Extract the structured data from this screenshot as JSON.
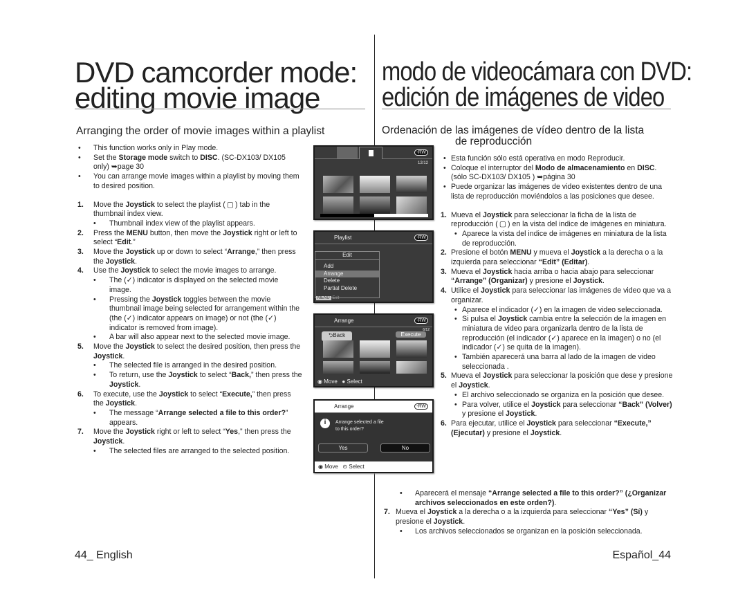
{
  "left": {
    "title_line1": "DVD camcorder mode:",
    "title_line2": "editing movie image",
    "subtitle": "Arranging the order of movie images within a playlist",
    "items": [
      {
        "k": "b",
        "parts": [
          "This function works only in Play mode."
        ]
      },
      {
        "k": "b",
        "parts": [
          "Set the ",
          {
            "b": "Storage mode"
          },
          " switch to ",
          {
            "b": "DISC"
          },
          ". (SC-DX103/ DX105 only) ➥page 30"
        ]
      },
      {
        "k": "b",
        "parts": [
          "You can arrange movie images within a playlist by moving them to desired position."
        ],
        "gap": true
      },
      {
        "k": "n",
        "num": "1.",
        "parts": [
          "Move the ",
          {
            "b": "Joystick"
          },
          " to select the playlist ( ▢ ) tab in the thumbnail index view."
        ]
      },
      {
        "k": "s",
        "parts": [
          "Thumbnail index view of the playlist appears."
        ]
      },
      {
        "k": "n",
        "num": "2.",
        "parts": [
          "Press the ",
          {
            "b": "MENU"
          },
          " button, then move the ",
          {
            "b": "Joystick"
          },
          " right or left to select “",
          {
            "b": "Edit"
          },
          ".”"
        ]
      },
      {
        "k": "n",
        "num": "3.",
        "parts": [
          "Move the ",
          {
            "b": "Joystick"
          },
          " up or down to select “",
          {
            "b": "Arrange"
          },
          ",” then press the ",
          {
            "b": "Joystick"
          },
          "."
        ]
      },
      {
        "k": "n",
        "num": "4.",
        "parts": [
          "Use the ",
          {
            "b": "Joystick"
          },
          " to select the movie images to arrange."
        ]
      },
      {
        "k": "s",
        "parts": [
          "The (✓) indicator is displayed on the selected movie image."
        ]
      },
      {
        "k": "s",
        "parts": [
          "Pressing the ",
          {
            "b": "Joystick"
          },
          " toggles between the movie thumbnail image being selected for arrangement within the (the (✓) indicator appears on image) or not (the (✓) indicator is removed from image)."
        ]
      },
      {
        "k": "s",
        "parts": [
          "A bar will also appear next to the selected movie image."
        ]
      },
      {
        "k": "n",
        "num": "5.",
        "parts": [
          "Move the ",
          {
            "b": "Joystick"
          },
          " to select the desired position, then press the ",
          {
            "b": "Joystick"
          },
          "."
        ]
      },
      {
        "k": "s",
        "parts": [
          "The selected file is arranged in the desired position."
        ]
      },
      {
        "k": "s",
        "parts": [
          "To return, use the ",
          {
            "b": "Joystick"
          },
          " to select “",
          {
            "b": "Back,"
          },
          "” then press the ",
          {
            "b": "Joystick"
          },
          "."
        ]
      },
      {
        "k": "n",
        "num": "6.",
        "parts": [
          "To execute, use the ",
          {
            "b": "Joystick"
          },
          " to select “",
          {
            "b": "Execute,"
          },
          "” then press the ",
          {
            "b": "Joystick"
          },
          "."
        ]
      },
      {
        "k": "s",
        "parts": [
          "The message “",
          {
            "b": "Arrange selected a file to this order?"
          },
          "” appears."
        ]
      },
      {
        "k": "n",
        "num": "7.",
        "parts": [
          "Move the ",
          {
            "b": "Joystick"
          },
          " right or left to select “",
          {
            "b": "Yes"
          },
          ",” then press the ",
          {
            "b": "Joystick"
          },
          "."
        ]
      },
      {
        "k": "s",
        "parts": [
          "The selected files are arranged to the selected position."
        ]
      }
    ],
    "footer": "44_ English"
  },
  "right": {
    "title_line1": "modo de videocámara con DVD:",
    "title_line2": "edición de imágenes de video",
    "subtitle_line1": "Ordenación de las imágenes de vídeo dentro de la lista",
    "subtitle_line2": "de reproducción",
    "items": [
      {
        "k": "b",
        "parts": [
          "Esta función sólo está operativa en modo Reproducir."
        ]
      },
      {
        "k": "b",
        "parts": [
          "Coloque el interruptor del ",
          {
            "b": "Modo de almacenamiento"
          },
          " en ",
          {
            "b": "DISC"
          },
          ". (sólo SC-DX103/ DX105 ) ➥página 30"
        ]
      },
      {
        "k": "b",
        "parts": [
          "Puede organizar las imágenes de video existentes dentro de una lista de reproducción moviéndolos a las posiciones que desee."
        ],
        "gap": true
      },
      {
        "k": "n",
        "num": "1.",
        "parts": [
          "Mueva el ",
          {
            "b": "Joystick"
          },
          " para seleccionar la ficha de la lista de reproducción ( ▢ ) en la vista del indice de imágenes en miniatura."
        ]
      },
      {
        "k": "s",
        "parts": [
          "Aparece la vista del indice de imágenes en miniatura de la lista de reproducción."
        ]
      },
      {
        "k": "n",
        "num": "2.",
        "parts": [
          "Presione el botón ",
          {
            "b": "MENU"
          },
          " y mueva el ",
          {
            "b": "Joystick"
          },
          " a la derecha o a la izquierda para seleccionar ",
          {
            "b": "“Edit” (Editar)"
          },
          "."
        ]
      },
      {
        "k": "n",
        "num": "3.",
        "parts": [
          "Mueva el ",
          {
            "b": "Joystick"
          },
          " hacia arriba o hacia abajo para seleccionar ",
          {
            "b": "“Arrange” (Organizar)"
          },
          " y presione el ",
          {
            "b": "Joystick"
          },
          "."
        ]
      },
      {
        "k": "n",
        "num": "4.",
        "parts": [
          "Utilice el ",
          {
            "b": "Joystick"
          },
          " para seleccionar las imágenes de video que va a organizar."
        ]
      },
      {
        "k": "s",
        "parts": [
          "Aparece el indicador (✓) en la imagen de video seleccionada."
        ]
      },
      {
        "k": "s",
        "parts": [
          "Si pulsa el ",
          {
            "b": "Joystick"
          },
          " cambia entre la selección de la imagen en miniatura de video para organizarla dentro de la lista de reproducción (el indicador (✓) aparece en la imagen) o no (el indicador (✓) se quita de la imagen)."
        ]
      },
      {
        "k": "s",
        "parts": [
          "También aparecerá una barra al lado de la imagen de video seleccionada ."
        ]
      },
      {
        "k": "n",
        "num": "5.",
        "parts": [
          "Mueva el ",
          {
            "b": "Joystick"
          },
          " para seleccionar la posición que dese y presione el ",
          {
            "b": "Joystick"
          },
          "."
        ]
      },
      {
        "k": "s",
        "parts": [
          "El archivo seleccionado se organiza en la posición que desee."
        ]
      },
      {
        "k": "s",
        "parts": [
          "Para volver, utilice el ",
          {
            "b": "Joystick"
          },
          " para seleccionar ",
          {
            "b": "“Back” (Volver)"
          },
          " y presione el ",
          {
            "b": "Joystick"
          },
          "."
        ]
      },
      {
        "k": "n",
        "num": "6.",
        "parts": [
          "Para ejecutar, utilice el ",
          {
            "b": "Joystick"
          },
          " para seleccionar ",
          {
            "b": "“Execute,” (Ejecutar)"
          },
          " y presione el ",
          {
            "b": "Joystick"
          },
          "."
        ]
      }
    ],
    "items_wide": [
      {
        "k": "s",
        "parts": [
          "Aparecerá el mensaje ",
          {
            "b": "“Arrange selected a file to this order?” (¿Organizar archivos seleccionados en este orden?)"
          },
          "."
        ]
      },
      {
        "k": "n",
        "num": "7.",
        "parts": [
          "Mueva el ",
          {
            "b": "Joystick"
          },
          " a la derecha o a la izquierda para seleccionar ",
          {
            "b": "“Yes” (Sí)"
          },
          " y presione el ",
          {
            "b": "Joystick"
          },
          "."
        ]
      },
      {
        "k": "s",
        "parts": [
          "Los archivos seleccionados se organizan en la posición seleccionada."
        ]
      }
    ],
    "footer": "Español_44"
  },
  "screens": {
    "s1": {
      "counter": "12/12",
      "rw": "-RW"
    },
    "s2": {
      "title": "Playlist",
      "rw": "-RW",
      "menu_title": "Edit",
      "menu": [
        "Add",
        "Arrange",
        "Delete",
        "Partial Delete"
      ],
      "selected": "Arrange",
      "menu_key": "MENU",
      "exit": "Exit"
    },
    "s3": {
      "title": "Arrange",
      "rw": "-RW",
      "counter": "6/12",
      "back": "Back",
      "execute": "Execute",
      "move": "Move",
      "select": "Select"
    },
    "s4": {
      "title": "Arrange",
      "rw": "-RW",
      "message_line1": "Arrange selected a file",
      "message_line2": "to this order?",
      "yes": "Yes",
      "no": "No",
      "move": "Move",
      "select": "Select"
    }
  }
}
